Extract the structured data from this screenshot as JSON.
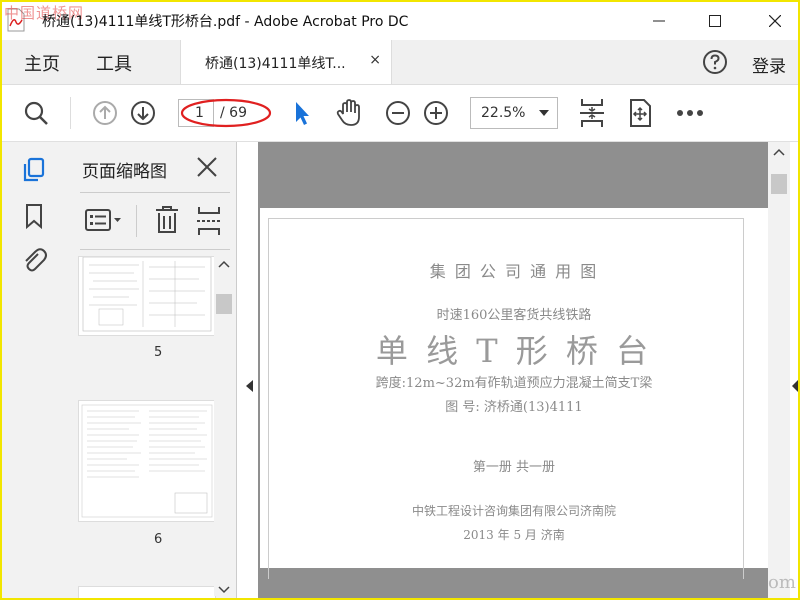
{
  "window": {
    "title": "桥通(13)4111单线T形桥台.pdf - Adobe Acrobat Pro DC",
    "watermark_top": "中国道桥网",
    "watermark_bottom": "om"
  },
  "menubar": {
    "home": "主页",
    "tools": "工具",
    "doc_tab": "桥通(13)4111单线T...",
    "doc_tab_close": "×",
    "login": "登录"
  },
  "toolbar": {
    "current_page": "1",
    "total_pages": "/ 69",
    "zoom": "22.5%"
  },
  "thumbnails": {
    "title": "页面缩略图",
    "pages": [
      {
        "num": "5"
      },
      {
        "num": "6"
      }
    ]
  },
  "document": {
    "line1": "集 团 公 司 通 用 图",
    "line2": "时速160公里客货共线铁路",
    "line3": "单 线 T 形 桥 台",
    "line4": "跨度:12m~32m有砟轨道预应力混凝土简支T梁",
    "line5": "图  号: 济桥通(13)4111",
    "line6": "第一册    共一册",
    "line7": "中铁工程设计咨询集团有限公司济南院",
    "line8": "2013 年 5 月  济南"
  },
  "colors": {
    "accent_blue": "#1a73d9",
    "annotation_red": "#e02020",
    "frame_yellow": "#f2e600"
  },
  "icons": [
    "search-icon",
    "page-up-icon",
    "page-down-icon",
    "select-cursor-icon",
    "hand-tool-icon",
    "zoom-out-icon",
    "zoom-in-icon",
    "fit-page-icon",
    "full-screen-icon",
    "more-icon",
    "help-icon",
    "thumbnails-icon",
    "bookmark-icon",
    "attachment-icon",
    "close-icon",
    "options-icon",
    "delete-icon",
    "extract-icon"
  ]
}
